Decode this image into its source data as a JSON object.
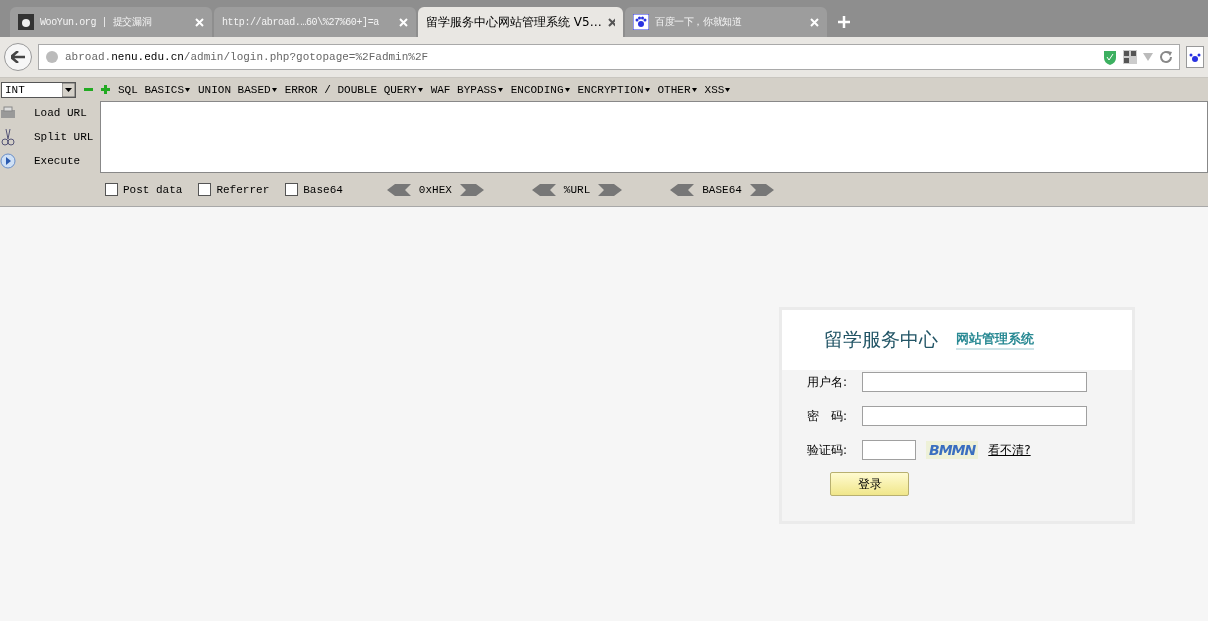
{
  "tabs": [
    {
      "label": "WooYun.org | 提交漏洞",
      "selected": false,
      "kind": "logo"
    },
    {
      "label": "http://abroad.…60\\%27%60+]=a",
      "selected": false,
      "kind": "plain"
    },
    {
      "label": "留学服务中心网站管理系统 V5…",
      "selected": true,
      "kind": "plain"
    },
    {
      "label": "百度一下，你就知道",
      "selected": false,
      "kind": "paw"
    }
  ],
  "address": {
    "host_prefix": "abroad.",
    "host": "nenu.edu.cn",
    "path": "/admin/login.php?gotopage=%2Fadmin%2F"
  },
  "hackbar": {
    "type_select": "INT",
    "menus": [
      "SQL BASICS",
      "UNION BASED",
      "ERROR / DOUBLE QUERY",
      "WAF BYPASS",
      "ENCODING",
      "ENCRYPTION",
      "OTHER",
      "XSS"
    ],
    "actions": [
      {
        "label": "Load URL",
        "kind": "load"
      },
      {
        "label": "Split URL",
        "kind": "split"
      },
      {
        "label": "Execute",
        "kind": "execute"
      }
    ],
    "options": [
      {
        "label": "Post data",
        "checked": false
      },
      {
        "label": "Referrer",
        "checked": false
      },
      {
        "label": "Base64",
        "checked": false
      }
    ],
    "encoders": [
      "0xHEX",
      "%URL",
      "BASE64"
    ]
  },
  "login": {
    "logo_main": "留学服务中心",
    "logo_sub": "网站管理系统",
    "fields": [
      {
        "label": "用户名:",
        "kind": "text"
      },
      {
        "label": "密　码:",
        "kind": "text"
      },
      {
        "label": "验证码:",
        "kind": "captcha"
      }
    ],
    "captcha": "BMMN",
    "refresh_link": "看不清?",
    "submit": "登录"
  }
}
